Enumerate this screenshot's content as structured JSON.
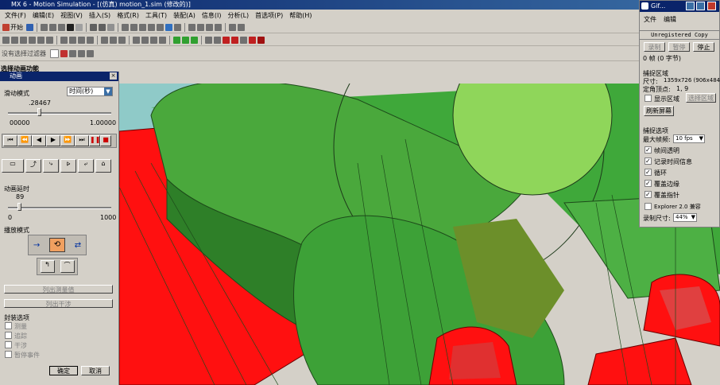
{
  "window": {
    "title": "MX 6 - Motion Simulation - [(仿真) motion_1.sim (修改的)]"
  },
  "menu": [
    "文件(F)",
    "编辑(E)",
    "视图(V)",
    "插入(S)",
    "格式(R)",
    "工具(T)",
    "装配(A)",
    "信息(I)",
    "分析(L)",
    "首选项(P)",
    "帮助(H)"
  ],
  "toolbar": {
    "start_label": "开始"
  },
  "breadcrumb_row": "没有选择过滤器",
  "status_label": "选择动画功能",
  "anim_panel": {
    "title": "动画",
    "slide_mode_label": "滑动模式",
    "slide_mode_value": "时间(秒)",
    "time_value": ".28467",
    "range_min": "00000",
    "range_max": "1.00000",
    "delay_label": "动画延时",
    "delay_value": "89",
    "delay_min": "0",
    "delay_max": "1000",
    "delay_fraction": 0.089,
    "time_fraction": 0.28467,
    "playback_label": "播放模式",
    "list_measure": "列出测量值",
    "list_interference": "列出干涉",
    "package_label": "封装选项",
    "options": [
      "测量",
      "追踪",
      "干涉",
      "暂停事件"
    ],
    "ok": "确定",
    "cancel": "取消"
  },
  "gif_window": {
    "title": "Gif...",
    "menu": [
      "文件",
      "编辑"
    ],
    "unregistered": "Unregistered Copy",
    "btn_record": "录制",
    "btn_pause": "暂停",
    "btn_stop": "停止",
    "frames": "0 帧 (0 字节)",
    "capture_area_label": "捕捉区域",
    "size_label": "尺寸:",
    "size_value": "1359x726 (906x484)",
    "pos_label": "定角顶点:",
    "pos_value": "1, 9",
    "show_area": "显示区域",
    "select_area": "选择区域",
    "refresh": "刷新屏幕",
    "capture_options_label": "捕捉选项",
    "max_fps_label": "最大帧频:",
    "max_fps_value": "10 fps",
    "options": [
      {
        "label": "帧间透明",
        "checked": true
      },
      {
        "label": "记录时间信息",
        "checked": true
      },
      {
        "label": "循环",
        "checked": true
      },
      {
        "label": "覆盖边缘",
        "checked": true
      },
      {
        "label": "覆盖指针",
        "checked": true
      },
      {
        "label": "Explorer 2.0 兼容",
        "checked": false
      }
    ],
    "record_size_label": "录制尺寸:",
    "record_size_value": "44%"
  },
  "colors": {
    "title": "#0a246a",
    "green": "#3fa83a",
    "red": "#ff1010",
    "face": "#d4d0c8"
  }
}
